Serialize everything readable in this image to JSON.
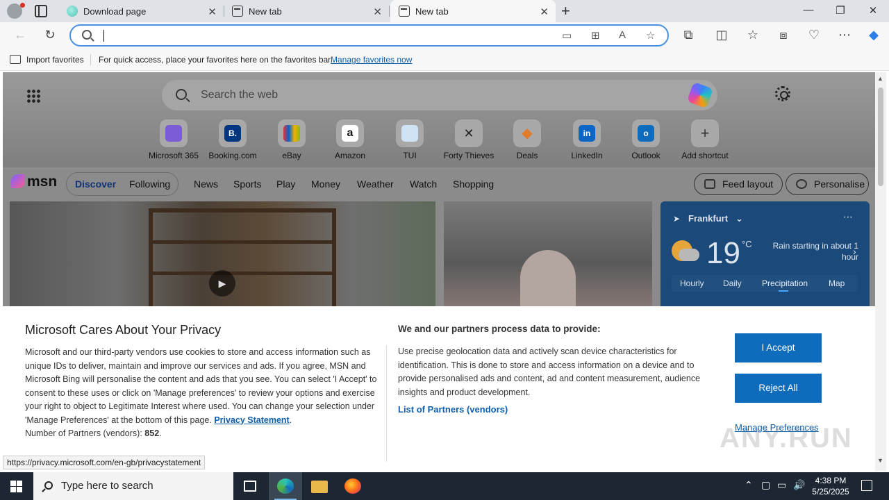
{
  "browser": {
    "tabs": [
      {
        "title": "Download page",
        "favicon": "download-page-favicon"
      },
      {
        "title": "New tab",
        "favicon": "new-tab-favicon"
      },
      {
        "title": "New tab",
        "favicon": "new-tab-favicon",
        "active": true
      }
    ],
    "address_value": "",
    "favorites_bar": {
      "import_label": "Import favorites",
      "hint": "For quick access, place your favorites here on the favorites bar.",
      "manage_link": "Manage favorites now"
    }
  },
  "newtab": {
    "search_placeholder": "Search the web",
    "shortcuts": [
      {
        "label": "Microsoft 365",
        "glyph": "",
        "color": "#7b5cd6"
      },
      {
        "label": "Booking.com",
        "glyph": "B.",
        "color": "#003580"
      },
      {
        "label": "eBay",
        "glyph": "",
        "color": "#e53238"
      },
      {
        "label": "Amazon",
        "glyph": "a",
        "color": "#111111"
      },
      {
        "label": "TUI",
        "glyph": "",
        "color": "#d4475c"
      },
      {
        "label": "Forty Thieves",
        "glyph": "✕",
        "color": "#222222"
      },
      {
        "label": "Deals",
        "glyph": "◆",
        "color": "#e07b2a"
      },
      {
        "label": "LinkedIn",
        "glyph": "in",
        "color": "#0a66c2"
      },
      {
        "label": "Outlook",
        "glyph": "o",
        "color": "#0f6cbd"
      },
      {
        "label": "Add shortcut",
        "glyph": "+",
        "color": "#333333"
      }
    ],
    "msn": {
      "logo": "msn",
      "nav": [
        "Discover",
        "Following",
        "News",
        "Sports",
        "Play",
        "Money",
        "Weather",
        "Watch",
        "Shopping"
      ],
      "feed_layout": "Feed layout",
      "personalise": "Personalise"
    },
    "weather": {
      "location": "Frankfurt",
      "temperature": "19",
      "unit": "°C",
      "description": "Rain starting in about 1 hour",
      "tabs": [
        "Hourly",
        "Daily",
        "Precipitation",
        "Map"
      ],
      "active_tab": "Precipitation"
    }
  },
  "privacy": {
    "title": "Microsoft Cares About Your Privacy",
    "body": "Microsoft and our third-party vendors use cookies to store and access information such as unique IDs to deliver, maintain and improve our services and ads. If you agree, MSN and Microsoft Bing will personalise the content and ads that you see. You can select 'I Accept' to consent to these uses or click on 'Manage preferences' to review your options and exercise your right to object to Legitimate Interest where used.  You can change your selection under 'Manage Preferences' at the bottom of this page.",
    "privacy_link": "Privacy Statement",
    "vendors_label": "Number of Partners (vendors):",
    "vendors_count": "852",
    "right_heading": "We and our partners process data to provide:",
    "right_body": "Use precise geolocation data and actively scan device characteristics for identification. This is done to store and access information on a device and to provide personalised ads and content, ad and content measurement, audience insights and product development.",
    "list_partners": "List of Partners (vendors)",
    "accept": "I Accept",
    "reject": "Reject All",
    "manage": "Manage Preferences"
  },
  "status_url": "https://privacy.microsoft.com/en-gb/privacystatement",
  "watermark": "ANY.RUN",
  "taskbar": {
    "search_placeholder": "Type here to search",
    "time": "4:38 PM",
    "date": "5/25/2025"
  }
}
